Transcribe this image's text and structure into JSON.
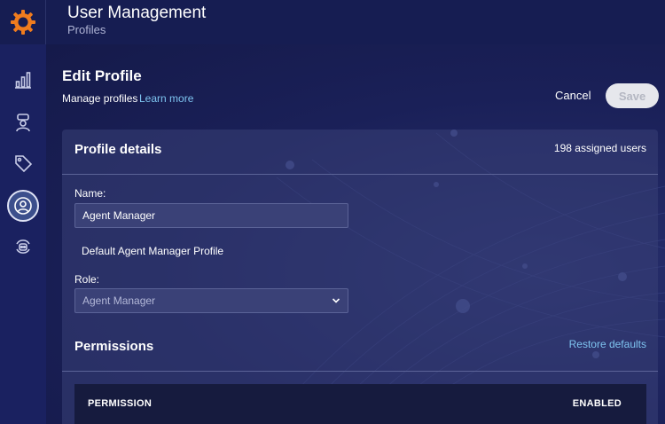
{
  "header": {
    "title": "User Management",
    "subtitle": "Profiles",
    "logo_icon": "sun-gear-logo-icon",
    "accent_color": "#f07c1e"
  },
  "sidenav": {
    "items": [
      {
        "icon": "bar-chart-icon",
        "active": false
      },
      {
        "icon": "agent-icon",
        "active": false
      },
      {
        "icon": "tag-icon",
        "active": false
      },
      {
        "icon": "user-profile-icon",
        "active": true
      },
      {
        "icon": "bot-refresh-icon",
        "active": false
      }
    ]
  },
  "page": {
    "title": "Edit Profile",
    "description": "Manage profiles",
    "learn_more": "Learn more",
    "cancel_label": "Cancel",
    "save_label": "Save"
  },
  "profile_details": {
    "title": "Profile details",
    "assigned_users": "198 assigned users",
    "name_label": "Name:",
    "name_value": "Agent Manager",
    "description_value": "Default Agent Manager Profile",
    "role_label": "Role:",
    "role_value": "Agent Manager"
  },
  "permissions": {
    "title": "Permissions",
    "restore_label": "Restore defaults",
    "columns": [
      "PERMISSION",
      "ENABLED"
    ]
  },
  "colors": {
    "background": "#141a4a",
    "link": "#7ec4f0",
    "card": "#384076"
  }
}
